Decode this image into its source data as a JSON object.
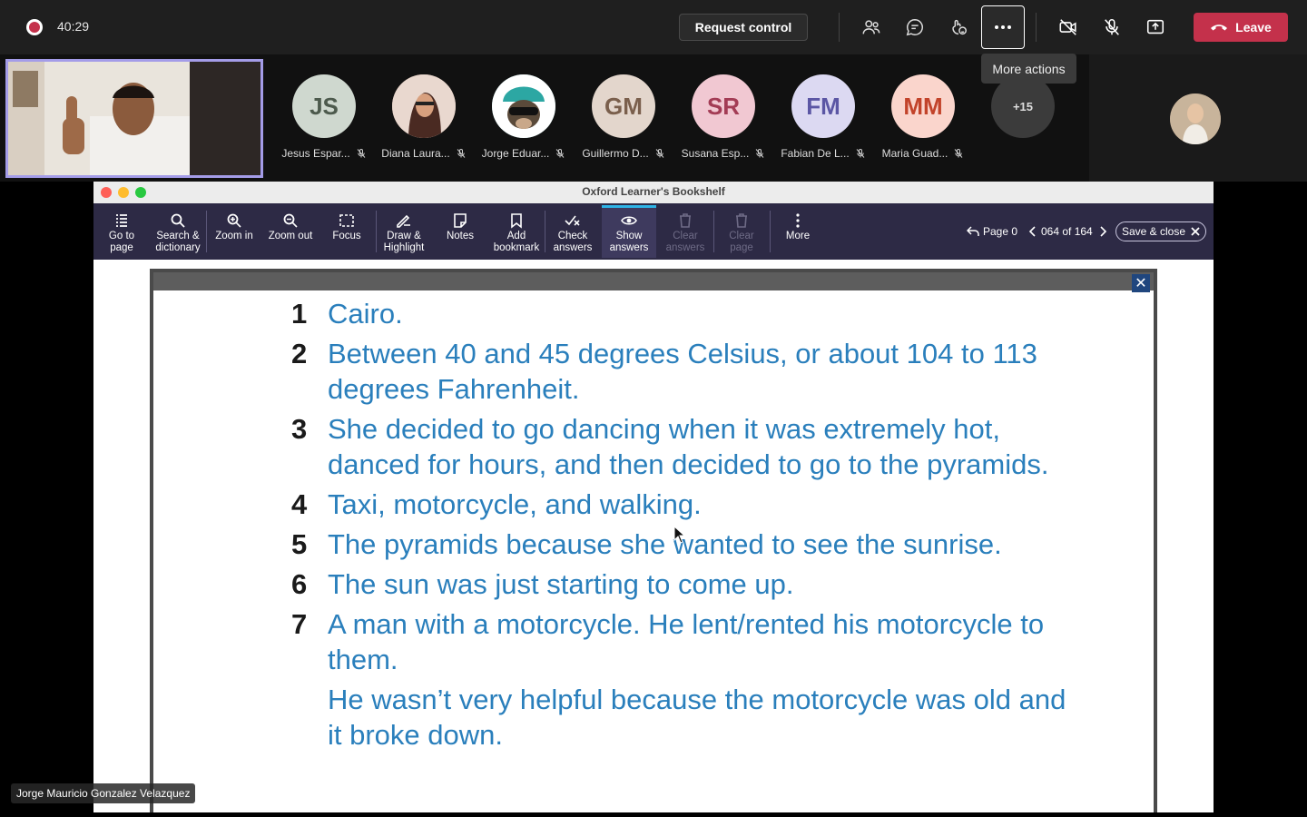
{
  "meeting": {
    "timer": "40:29",
    "request_control_label": "Request control",
    "leave_label": "Leave",
    "tooltip": "More actions",
    "icons": [
      "people-icon",
      "chat-icon",
      "reactions-icon",
      "more-actions-icon",
      "camera-off-icon",
      "mic-off-icon",
      "share-icon"
    ]
  },
  "participants": [
    {
      "initials": "JS",
      "name": "Jesus Espar...",
      "bg": "#cfd8cf",
      "fg": "#4d5a4d"
    },
    {
      "initials": "",
      "name": "Diana Laura...",
      "bg": "#c79a84",
      "fg": "#fff"
    },
    {
      "initials": "",
      "name": "Jorge Eduar...",
      "bg": "#4ea6a6",
      "fg": "#fff"
    },
    {
      "initials": "GM",
      "name": "Guillermo D...",
      "bg": "#e3d6cc",
      "fg": "#7a5f4c"
    },
    {
      "initials": "SR",
      "name": "Susana Esp...",
      "bg": "#f1c8d2",
      "fg": "#a33c55"
    },
    {
      "initials": "FM",
      "name": "Fabian De L...",
      "bg": "#dcd9f2",
      "fg": "#5b56a4"
    },
    {
      "initials": "MM",
      "name": "Maria Guad...",
      "bg": "#fad5cc",
      "fg": "#c2432a"
    }
  ],
  "more_participants": "+15",
  "speaker_name": "Jorge Mauricio Gonzalez Velazquez",
  "app": {
    "window_title": "Oxford Learner's Bookshelf",
    "tools": [
      {
        "label1": "Go to",
        "label2": "page"
      },
      {
        "label1": "Search &",
        "label2": "dictionary"
      },
      {
        "label1": "Zoom in",
        "label2": ""
      },
      {
        "label1": "Zoom out",
        "label2": ""
      },
      {
        "label1": "Focus",
        "label2": ""
      },
      {
        "label1": "Draw &",
        "label2": "Highlight"
      },
      {
        "label1": "Notes",
        "label2": ""
      },
      {
        "label1": "Add",
        "label2": "bookmark"
      },
      {
        "label1": "Check",
        "label2": "answers"
      },
      {
        "label1": "Show",
        "label2": "answers"
      },
      {
        "label1": "Clear",
        "label2": "answers"
      },
      {
        "label1": "Clear",
        "label2": "page"
      },
      {
        "label1": "More",
        "label2": ""
      }
    ],
    "page_label": "Page 0",
    "page_position": "064 of 164",
    "save_close_label": "Save & close"
  },
  "answers": [
    {
      "num": "1",
      "text": "Cairo."
    },
    {
      "num": "2",
      "text": "Between 40 and 45 degrees Celsius, or about 104 to 113 degrees Fahrenheit."
    },
    {
      "num": "3",
      "text": "She decided to go dancing when it was extremely hot, danced for hours, and then decided to go to the pyramids."
    },
    {
      "num": "4",
      "text": "Taxi, motorcycle, and walking."
    },
    {
      "num": "5",
      "text": "The pyramids because she wanted to see the sunrise."
    },
    {
      "num": "6",
      "text": "The sun was just starting to come up."
    },
    {
      "num": "7",
      "text": "A man with a motorcycle. He lent/rented his motorcycle to them."
    }
  ],
  "answer_extra": "He wasn’t very helpful because the motorcycle was old and it broke down."
}
